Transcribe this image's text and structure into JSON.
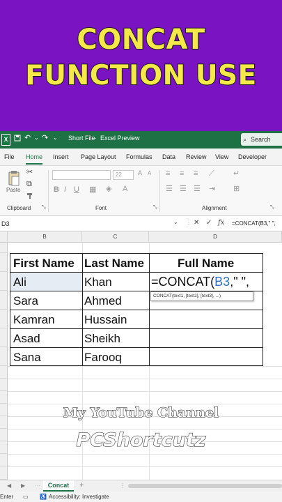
{
  "banner": {
    "line1": "CONCAT",
    "line2": "FUNCTION USE"
  },
  "titlebar": {
    "logo": "X",
    "autosave_icon": "save-icon",
    "undo": "↶",
    "redo": "↷",
    "more": "⌄",
    "file_name": "Short File",
    "separator": "-",
    "mode": "Excel Preview",
    "search": "Search"
  },
  "ribbon_tabs": [
    "File",
    "Home",
    "Insert",
    "Page Layout",
    "Formulas",
    "Data",
    "Review",
    "View",
    "Developer"
  ],
  "ribbon_groups": {
    "clipboard": "Clipboard",
    "font": "Font",
    "alignment": "Alignment"
  },
  "ribbon": {
    "paste_label": "Paste",
    "font_size": "22",
    "bold": "B",
    "italic": "I",
    "underline": "U"
  },
  "formula_bar": {
    "name_box": "D3",
    "cancel": "✕",
    "enter": "✓",
    "fx": "fx",
    "content": "=CONCAT(B3,\" \","
  },
  "columns": [
    "B",
    "C",
    "D"
  ],
  "table": {
    "headers": [
      "First Name",
      "Last Name",
      "Full Name"
    ],
    "rows": [
      [
        "Ali",
        "Khan"
      ],
      [
        "Sara",
        "Ahmed"
      ],
      [
        "Kamran",
        "Hussain"
      ],
      [
        "Asad",
        "Sheikh"
      ],
      [
        "Sana",
        "Farooq"
      ]
    ]
  },
  "editing": {
    "prefix": "=CONCAT(",
    "ref": "B3",
    "suffix": ",\" \",",
    "tooltip": "CONCAT(text1, [text2], [text3], ...)"
  },
  "overlay": {
    "line1": "My YouTube Channel",
    "line2": "PCShortcutz"
  },
  "sheet": {
    "tab": "Concat",
    "add": "+"
  },
  "status": {
    "mode": "Enter",
    "accessibility": "Accessibility: Investigate"
  },
  "colors": {
    "banner": "#7a14c2",
    "banner_text": "#f5e94a",
    "excel_green": "#1e7145",
    "ref_blue": "#2f6fc7"
  }
}
